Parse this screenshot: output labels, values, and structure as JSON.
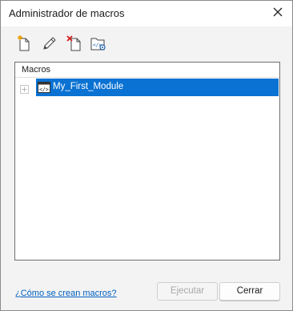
{
  "window": {
    "title": "Administrador de macros"
  },
  "toolbar": {
    "buttons": [
      {
        "icon": "new-module-icon"
      },
      {
        "icon": "edit-pencil-icon"
      },
      {
        "icon": "delete-module-icon"
      },
      {
        "icon": "module-properties-icon"
      }
    ]
  },
  "tree": {
    "header": "Macros",
    "items": [
      {
        "label": "My_First_Module",
        "selected": true,
        "icon": "code-module-icon"
      }
    ]
  },
  "footer": {
    "help_link": "¿Cómo se crean macros?",
    "run_label": "Ejecutar",
    "close_label": "Cerrar"
  },
  "colors": {
    "selection": "#0a72d2",
    "link": "#0060c0"
  }
}
